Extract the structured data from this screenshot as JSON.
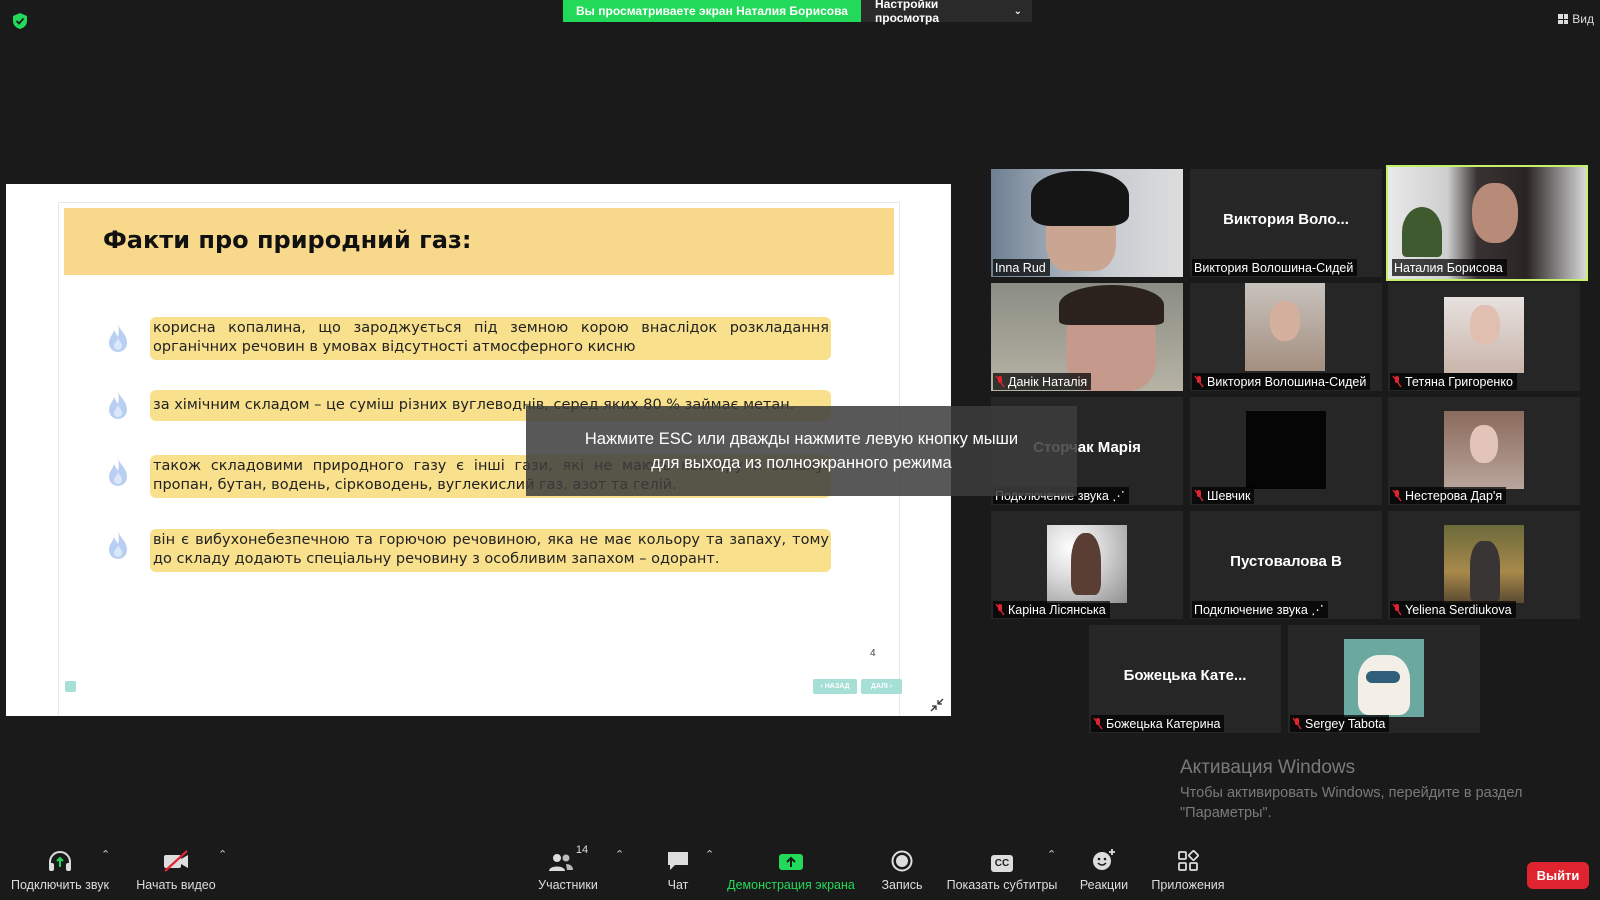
{
  "top_bar": {
    "share_banner": "Вы просматриваете экран Наталия Борисова",
    "view_settings": "Настройки просмотра",
    "view_button": "Вид"
  },
  "slide": {
    "title": "Факти про природний газ:",
    "facts": [
      "корисна копалина, що зароджується під земною корою внаслідок розкладання органічних речовин в умовах відсутності атмосферного кисню",
      "за хімічним складом – це суміш різних вуглеводнів, серед яких 80 % займає метан.",
      "також складовими природного газу є інші гази, які не мають кольору й запаху: пропан, бутан, водень, сірководень, вуглекислий газ, азот та гелій.",
      "він є вибухонебезпечною та горючою речовиною, яка не має кольору та запаху, тому до складу додають спеціальну речовину з особливим запахом – одорант."
    ],
    "page_number": "4",
    "back_label": "‹ НАЗАД",
    "next_label": "ДАЛІ ›"
  },
  "overlay": {
    "line1": "Нажмите ESC или дважды нажмите левую кнопку мыши",
    "line2": "для выхода из полноэкранного режима"
  },
  "participants": [
    {
      "label": "Inna Rud",
      "muted": false
    },
    {
      "big": "Виктория  Воло...",
      "label": "Виктория Волошина-Сидей",
      "muted": false
    },
    {
      "label": "Наталия Борисова",
      "muted": false,
      "active": true
    },
    {
      "label": "Данік Наталія",
      "muted": true
    },
    {
      "label": "Виктория Волошина-Сидей",
      "muted": true
    },
    {
      "label": "Тетяна Григоренко",
      "muted": true
    },
    {
      "big": "Сторчак Марія",
      "label": "Подключение звука ⋰",
      "muted": false
    },
    {
      "label": "Шевчик",
      "muted": true
    },
    {
      "label": "Нестерова Дар'я",
      "muted": true
    },
    {
      "label": "Каріна Лісянська",
      "muted": true
    },
    {
      "big": "Пустовалова В",
      "label": "Подключение звука ⋰",
      "muted": false
    },
    {
      "label": "Yeliena Serdiukova",
      "muted": true
    },
    {
      "big": "Божецька  Кате...",
      "label": "Божецька Катерина",
      "muted": true
    },
    {
      "label": "Sergey Tabota",
      "muted": true
    }
  ],
  "watermark": {
    "title": "Активация Windows",
    "line1": "Чтобы активировать Windows, перейдите в раздел",
    "line2": "\"Параметры\"."
  },
  "toolbar": {
    "audio": "Подключить звук",
    "video": "Начать видео",
    "participants": "Участники",
    "participants_count": "14",
    "chat": "Чат",
    "share": "Демонстрация экрана",
    "record": "Запись",
    "captions": "Показать субтитры",
    "captions_icon_text": "CC",
    "reactions": "Реакции",
    "apps": "Приложения",
    "exit": "Выйти"
  },
  "colors": {
    "share_green": "#23d959",
    "active_speaker": "#c7f06a",
    "slide_yellow": "#f8d98c",
    "exit_red": "#e0242f"
  }
}
